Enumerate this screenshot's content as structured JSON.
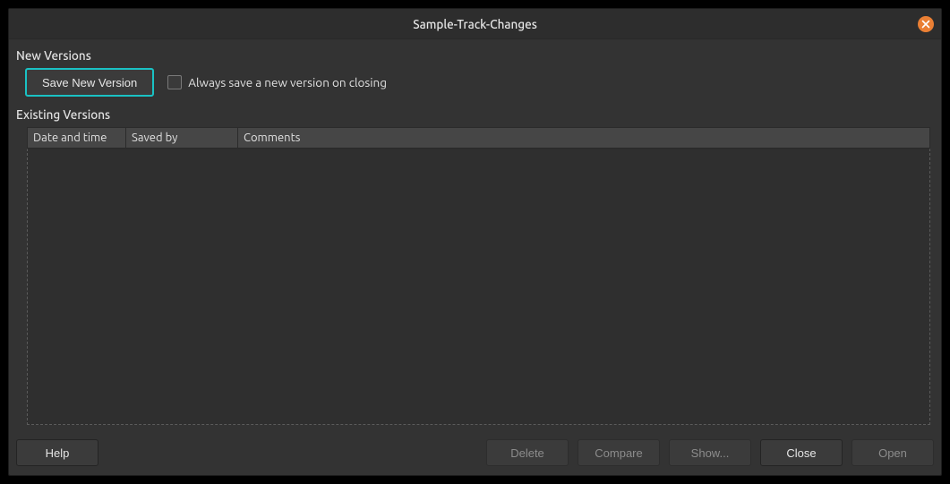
{
  "title": "Sample-Track-Changes",
  "sections": {
    "new_versions_label": "New Versions",
    "existing_versions_label": "Existing Versions"
  },
  "new_versions": {
    "save_button": "Save New Version",
    "always_save_label": "Always save a new version on closing",
    "always_save_checked": false
  },
  "table": {
    "columns": {
      "date_time": "Date and time",
      "saved_by": "Saved by",
      "comments": "Comments"
    },
    "rows": []
  },
  "footer": {
    "help": "Help",
    "delete": "Delete",
    "compare": "Compare",
    "show": "Show...",
    "close": "Close",
    "open": "Open"
  }
}
